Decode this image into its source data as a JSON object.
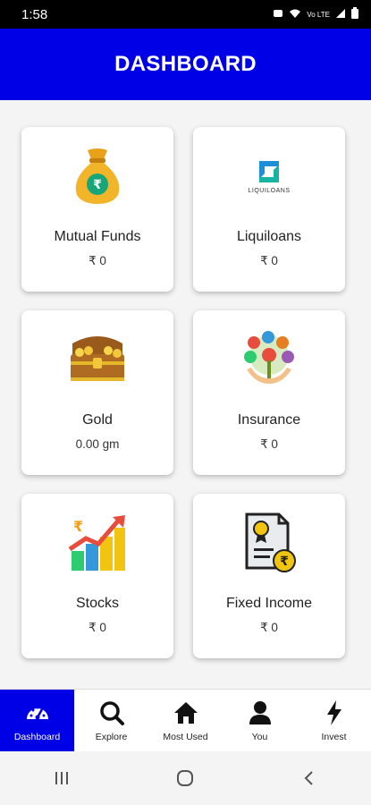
{
  "status": {
    "time": "1:58",
    "icons": [
      "alarm-icon",
      "wifi-icon",
      "volte-icon",
      "signal-icon",
      "battery-icon"
    ],
    "volte_text": "Vo LTE"
  },
  "app_bar": {
    "title": "DASHBOARD",
    "color": "#0000e6"
  },
  "cards": [
    {
      "label": "Mutual Funds",
      "value": "₹ 0",
      "icon": "money-bag-icon"
    },
    {
      "label": "Liquiloans",
      "value": "₹ 0",
      "icon": "liquiloans-logo",
      "logo_text": "LIQUILOANS"
    },
    {
      "label": "Gold",
      "value": "0.00 gm",
      "icon": "treasure-chest-icon"
    },
    {
      "label": "Insurance",
      "value": "₹ 0",
      "icon": "insurance-icon"
    },
    {
      "label": "Stocks",
      "value": "₹ 0",
      "icon": "stocks-chart-icon"
    },
    {
      "label": "Fixed Income",
      "value": "₹ 0",
      "icon": "certificate-icon"
    }
  ],
  "bottom_nav": [
    {
      "label": "Dashboard",
      "icon": "speedometer-icon",
      "active": true
    },
    {
      "label": "Explore",
      "icon": "search-icon",
      "active": false
    },
    {
      "label": "Most Used",
      "icon": "home-icon",
      "active": false
    },
    {
      "label": "You",
      "icon": "user-icon",
      "active": false
    },
    {
      "label": "Invest",
      "icon": "bolt-icon",
      "active": false
    }
  ]
}
